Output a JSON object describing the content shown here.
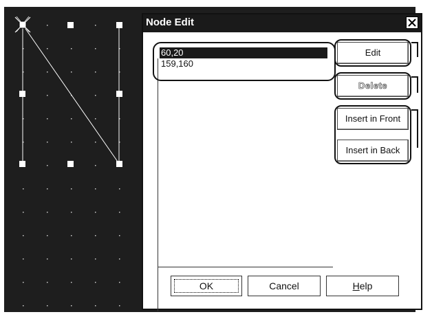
{
  "dialog": {
    "title": "Node Edit",
    "close_glyph": "✕",
    "nodes": [
      "60,20",
      "159,160"
    ],
    "selected_index": 0,
    "buttons": {
      "edit": "Edit",
      "delete": "Delete",
      "insert_front": "Insert in Front",
      "insert_back": "Insert in Back",
      "ok": "OK",
      "cancel": "Cancel",
      "help_mnemonic": "H",
      "help_rest": "elp"
    }
  },
  "colors": {
    "canvas_bg": "#1e1e1e",
    "grid_dot": "#cfcfcf",
    "titlebar": "#1a1a1a",
    "selection": "#1a1a1a"
  },
  "icons": {
    "close": "close-icon",
    "handle": "square-handle-icon",
    "start_node": "start-node-icon"
  }
}
